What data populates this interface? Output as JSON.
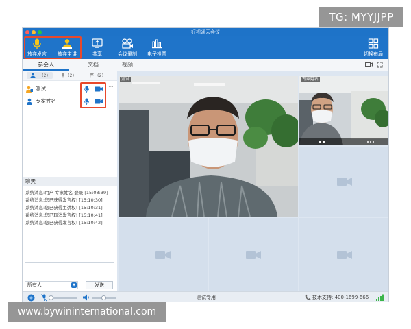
{
  "watermarks": {
    "top_right": "TG: MYYJJPP",
    "bottom_left": "www.bywininternational.com"
  },
  "window": {
    "title": "好视通云会议"
  },
  "colors": {
    "toolbar_bg": "#1f74c9",
    "highlight": "#e8492c",
    "accent_blue": "#1f74c9",
    "mic_yellow": "#f5c518",
    "signal_green": "#3bb54a"
  },
  "toolbar": {
    "give_up_speak": {
      "label": "放弃发言",
      "icon": "microphone-icon"
    },
    "give_up_host": {
      "label": "放弃主讲",
      "icon": "presenter-icon"
    },
    "share": {
      "label": "共享",
      "icon": "share-screen-icon"
    },
    "record": {
      "label": "会议录制",
      "icon": "record-icon"
    },
    "vote": {
      "label": "电子投票",
      "icon": "vote-icon"
    },
    "layout": {
      "label": "切换布局",
      "icon": "layout-grid-icon"
    }
  },
  "tabs": {
    "participants": "参会人",
    "documents": "文档",
    "video": "视频"
  },
  "filters": {
    "all": "(2)",
    "mic": "(2)",
    "host": "(2)"
  },
  "participants": [
    {
      "name": "测试",
      "mic_icon": "mic-icon",
      "cam_icon": "camera-icon"
    },
    {
      "name": "专家姓名",
      "mic_icon": "mic-icon",
      "cam_icon": "camera-icon"
    }
  ],
  "chat": {
    "title": "聊天",
    "lines": [
      "系统消息:用户 专家姓名 登录 [15:08:39]",
      "系统消息:您已获得发言权! [15:10:30]",
      "系统消息:您已获得主讲权! [15:10:31]",
      "系统消息:您已取消发言权! [15:10:41]",
      "系统消息:您已获得发言权! [15:10:42]"
    ],
    "recipient": "所有人",
    "send_label": "发送"
  },
  "video": {
    "main_name": "测试",
    "side_name": "专家姓名"
  },
  "status": {
    "center": "测试专用",
    "support": "技术支持:  400-1699-666"
  }
}
